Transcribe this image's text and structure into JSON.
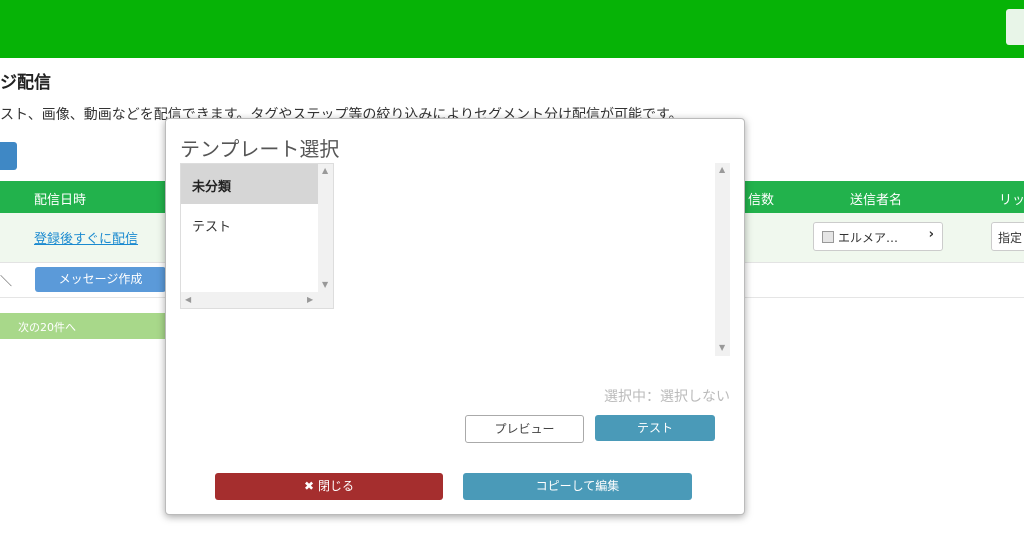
{
  "page": {
    "title": "ジ配信",
    "description": "スト、画像、動画などを配信できます。タグやステップ等の絞り込みによりセグメント分け配信が可能です。"
  },
  "table": {
    "headers": {
      "date": "配信日時",
      "count": "信数",
      "sender": "送信者名",
      "last": "リッ"
    },
    "row": {
      "date_link": "登録後すぐに配信",
      "sender": "エルメア…",
      "specify": "指定"
    },
    "row2_mark": "＼",
    "message_create": "メッセージ作成",
    "next_page": "次の20件へ"
  },
  "modal": {
    "title": "テンプレート選択",
    "categories": [
      {
        "label": "未分類",
        "selected": true
      },
      {
        "label": "テスト",
        "selected": false
      }
    ],
    "selected_status": "選択中：選択しない",
    "preview_label": "プレビュー",
    "test_label": "テスト",
    "close_icon": "✖",
    "close_label": "閉じる",
    "copy_edit_label": "コピーして編集"
  },
  "colors": {
    "topbar": "#06b306",
    "table_header": "#22b24c",
    "close_button": "#a52e2e",
    "action_button": "#4a9ab8"
  }
}
